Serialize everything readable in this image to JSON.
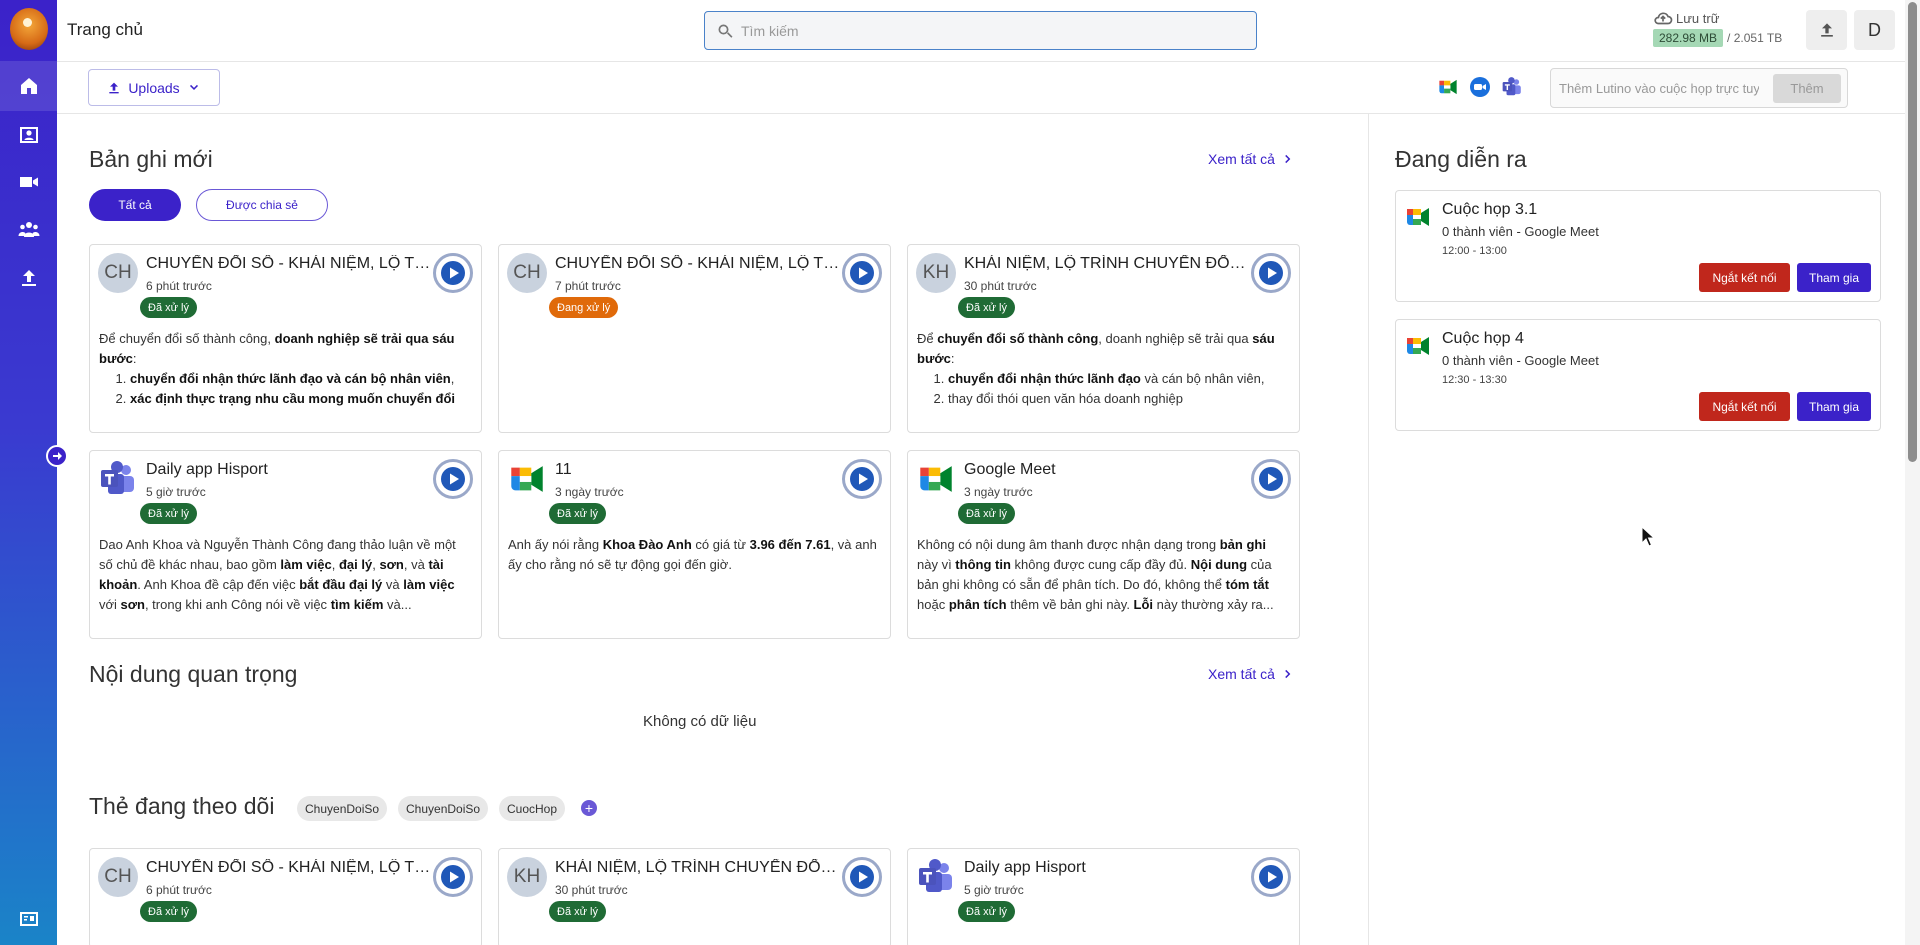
{
  "app": {
    "breadcrumb": "Trang chủ"
  },
  "search": {
    "placeholder": "Tìm kiếm"
  },
  "storage": {
    "label": "Lưu trữ",
    "used": "282.98 MB",
    "total": "/ 2.051 TB"
  },
  "user": {
    "avatar_letter": "D"
  },
  "toolbar": {
    "uploads_label": "Uploads",
    "meeting_input_placeholder": "Thêm Lutino vào cuộc họp trực tuyến",
    "meeting_add_label": "Thêm"
  },
  "recent": {
    "title": "Bản ghi mới",
    "see_all": "Xem tất cả",
    "filters": [
      "Tất cả",
      "Được chia sẻ"
    ],
    "cards": [
      {
        "avatar": "CH",
        "title": "CHUYỂN ĐỔI SỐ - KHÁI NIỆM, LỘ TRÌNH CHUYỂN ĐỔI SỐ",
        "time": "6 phút trước",
        "status": "Đã xử lý"
      },
      {
        "avatar": "CH",
        "title": "CHUYỂN ĐỔI SỐ - KHÁI NIỆM, LỘ TRÌNH CHUYỂN ĐỔI SỐ",
        "time": "7 phút trước",
        "status": "Đang xử lý"
      },
      {
        "avatar": "KH",
        "title": "KHÁI NIỆM, LỘ TRÌNH CHUYỂN ĐỔI SỐ",
        "time": "30 phút trước",
        "status": "Đã xử lý"
      },
      {
        "icon": "teams-icon",
        "title": "Daily app Hisport",
        "time": "5 giờ trước",
        "status": "Đã xử lý"
      },
      {
        "icon": "google-meet-icon",
        "title": "11",
        "time": "3 ngày trước",
        "status": "Đã xử lý"
      },
      {
        "icon": "google-meet-icon",
        "title": "Google Meet",
        "time": "3 ngày trước",
        "status": "Đã xử lý"
      }
    ]
  },
  "important": {
    "title": "Nội dung quan trọng",
    "see_all": "Xem tất cả",
    "empty": "Không có dữ liệu"
  },
  "tracked": {
    "title": "Thẻ đang theo dõi",
    "tags": [
      "ChuyenDoiSo",
      "ChuyenDoiSo",
      "CuocHop"
    ],
    "cards": [
      {
        "avatar": "CH",
        "title": "CHUYỂN ĐỔI SỐ - KHÁI NIỆM, LỘ TRÌNH CHUYỂN ĐỔI SỐ",
        "time": "6 phút trước",
        "status": "Đã xử lý"
      },
      {
        "avatar": "KH",
        "title": "KHÁI NIỆM, LỘ TRÌNH CHUYỂN ĐỔI SỐ",
        "time": "30 phút trước",
        "status": "Đã xử lý"
      },
      {
        "icon": "teams-icon",
        "title": "Daily app Hisport",
        "time": "5 giờ trước",
        "status": "Đã xử lý"
      }
    ]
  },
  "live": {
    "title": "Đang diễn ra",
    "meetings": [
      {
        "title": "Cuộc họp 3.1",
        "subtitle": "0 thành viên - Google Meet",
        "time": "12:00 - 13:00",
        "disconnect": "Ngắt kết nối",
        "join": "Tham gia"
      },
      {
        "title": "Cuộc họp 4",
        "subtitle": "0 thành viên - Google Meet",
        "time": "12:30 - 13:30",
        "disconnect": "Ngắt kết nối",
        "join": "Tham gia"
      }
    ]
  },
  "colors": {
    "primary": "#3b22c9",
    "success": "#1f6b35",
    "warning": "#e06a0a",
    "danger": "#c0271c"
  }
}
